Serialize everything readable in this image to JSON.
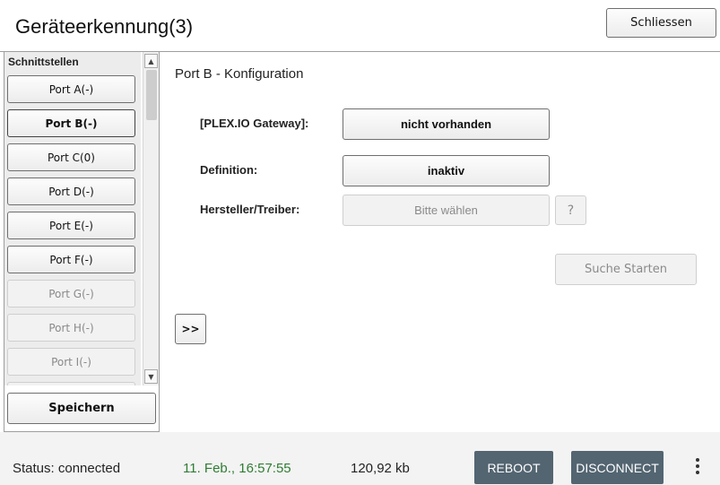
{
  "header": {
    "title": "Geräteerkennung(3)",
    "close_label": "Schliessen"
  },
  "sidebar": {
    "heading": "Schnittstellen",
    "ports": [
      {
        "label": "Port A(-)",
        "state": "enabled"
      },
      {
        "label": "Port B(-)",
        "state": "active"
      },
      {
        "label": "Port C(0)",
        "state": "enabled"
      },
      {
        "label": "Port D(-)",
        "state": "enabled"
      },
      {
        "label": "Port E(-)",
        "state": "enabled"
      },
      {
        "label": "Port F(-)",
        "state": "enabled"
      },
      {
        "label": "Port G(-)",
        "state": "disabled"
      },
      {
        "label": "Port H(-)",
        "state": "disabled"
      },
      {
        "label": "Port I(-)",
        "state": "disabled"
      }
    ],
    "save_label": "Speichern"
  },
  "main": {
    "title": "Port B - Konfiguration",
    "gateway_label": "[PLEX.IO Gateway]:",
    "gateway_value": "nicht vorhanden",
    "definition_label": "Definition:",
    "definition_value": "inaktiv",
    "vendor_label": "Hersteller/Treiber:",
    "vendor_placeholder": "Bitte wählen",
    "help_label": "?",
    "search_label": "Suche Starten",
    "expand_label": ">>"
  },
  "footer": {
    "status": "Status: connected",
    "time": "11. Feb., 16:57:55",
    "size": "120,92 kb",
    "reboot_label": "REBOOT",
    "disconnect_label": "DISCONNECT",
    "time_color": "#2e7d32",
    "button_color": "#536571"
  },
  "icons": {
    "scroll_up": "chevron-up-icon",
    "scroll_down": "chevron-down-icon",
    "menu": "more-vertical-icon"
  }
}
